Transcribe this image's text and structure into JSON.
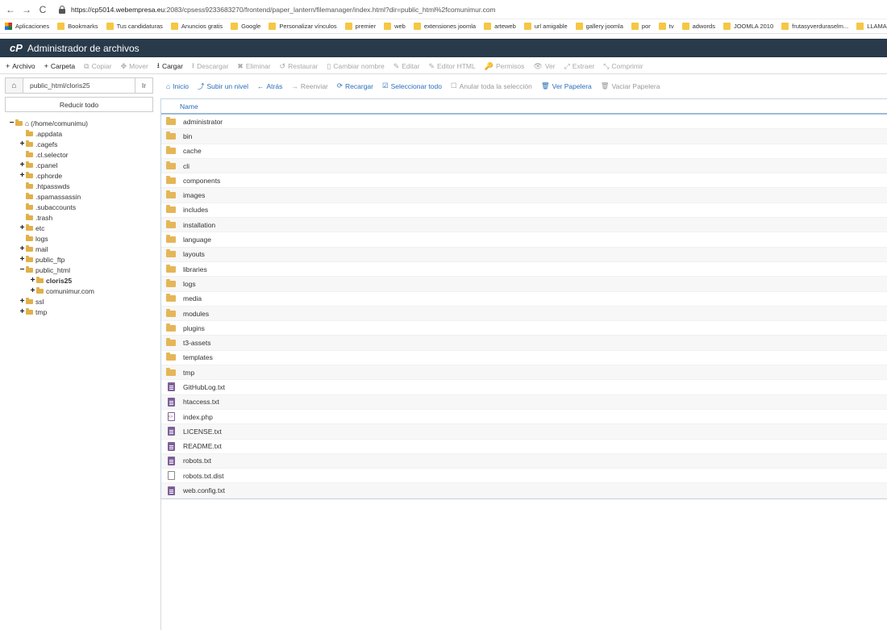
{
  "browser": {
    "back": "←",
    "forward": "→",
    "reload": "C",
    "url_host": "https://cp5014.webempresa.eu",
    "url_rest": ":2083/cpsess9233683270/frontend/paper_lantern/filemanager/index.html?dir=public_html%2fcomunimur.com",
    "bookmarks": [
      "Aplicaciones",
      "Bookmarks",
      "Tus candidaturas",
      "Anuncios gratis",
      "Google",
      "Personalizar vínculos",
      "premier",
      "web",
      "extensiones joomla",
      "arteweb",
      "url amigable",
      "gallery joomla",
      "por",
      "tv",
      "adwords",
      "JOOMLA 2010",
      "frutasyverduraselm...",
      "LLAMAR"
    ]
  },
  "header": {
    "logo": "cP",
    "title": "Administrador de archivos"
  },
  "toolbar": [
    {
      "label": "Archivo",
      "glyph": "+",
      "enabled": true
    },
    {
      "label": "Carpeta",
      "glyph": "+",
      "enabled": true
    },
    {
      "label": "Copiar",
      "glyph": "⧉",
      "enabled": false
    },
    {
      "label": "Mover",
      "glyph": "✥",
      "enabled": false
    },
    {
      "label": "Cargar",
      "glyph": "⭳",
      "enabled": true
    },
    {
      "label": "Descargar",
      "glyph": "⭳",
      "enabled": false
    },
    {
      "label": "Eliminar",
      "glyph": "✖",
      "enabled": false
    },
    {
      "label": "Restaurar",
      "glyph": "↺",
      "enabled": false
    },
    {
      "label": "Cambiar nombre",
      "glyph": "▯",
      "enabled": false
    },
    {
      "label": "Editar",
      "glyph": "✎",
      "enabled": false
    },
    {
      "label": "Editor HTML",
      "glyph": "✎",
      "enabled": false
    },
    {
      "label": "Permisos",
      "glyph": "🔑",
      "enabled": false
    },
    {
      "label": "Ver",
      "glyph": "👁",
      "enabled": false
    },
    {
      "label": "Extraer",
      "glyph": "⤢",
      "enabled": false
    },
    {
      "label": "Comprimir",
      "glyph": "⤡",
      "enabled": false
    }
  ],
  "sidebar": {
    "path_value": "public_html/cloris25",
    "go_label": "Ir",
    "collapse_label": "Reducir todo",
    "tree": [
      {
        "label": "(/home/comunimu)",
        "level": 0,
        "toggle": "−",
        "home": true
      },
      {
        "label": ".appdata",
        "level": 1,
        "toggle": ""
      },
      {
        "label": ".cagefs",
        "level": 1,
        "toggle": "+"
      },
      {
        "label": ".cl.selector",
        "level": 1,
        "toggle": ""
      },
      {
        "label": ".cpanel",
        "level": 1,
        "toggle": "+"
      },
      {
        "label": ".cphorde",
        "level": 1,
        "toggle": "+"
      },
      {
        "label": ".htpasswds",
        "level": 1,
        "toggle": ""
      },
      {
        "label": ".spamassassin",
        "level": 1,
        "toggle": ""
      },
      {
        "label": ".subaccounts",
        "level": 1,
        "toggle": ""
      },
      {
        "label": ".trash",
        "level": 1,
        "toggle": ""
      },
      {
        "label": "etc",
        "level": 1,
        "toggle": "+"
      },
      {
        "label": "logs",
        "level": 1,
        "toggle": ""
      },
      {
        "label": "mail",
        "level": 1,
        "toggle": "+"
      },
      {
        "label": "public_ftp",
        "level": 1,
        "toggle": "+"
      },
      {
        "label": "public_html",
        "level": 1,
        "toggle": "−"
      },
      {
        "label": "cloris25",
        "level": 2,
        "toggle": "+",
        "bold": true
      },
      {
        "label": "comunimur.com",
        "level": 2,
        "toggle": "+"
      },
      {
        "label": "ssl",
        "level": 1,
        "toggle": "+"
      },
      {
        "label": "tmp",
        "level": 1,
        "toggle": "+"
      }
    ]
  },
  "nav": [
    {
      "label": "Inicio",
      "glyph": "⌂",
      "enabled": true
    },
    {
      "label": "Subir un nivel",
      "glyph": "⤴",
      "enabled": true
    },
    {
      "label": "Atrás",
      "glyph": "←",
      "enabled": true
    },
    {
      "label": "Reenviar",
      "glyph": "→",
      "enabled": false
    },
    {
      "label": "Recargar",
      "glyph": "⟳",
      "enabled": true
    },
    {
      "label": "Seleccionar todo",
      "glyph": "☑",
      "enabled": true
    },
    {
      "label": "Anular toda la selección",
      "glyph": "☐",
      "enabled": false
    },
    {
      "label": "Ver Papelera",
      "glyph": "🗑",
      "enabled": true
    },
    {
      "label": "Vaciar Papelera",
      "glyph": "🗑",
      "enabled": false
    }
  ],
  "table": {
    "column_name": "Name",
    "rows": [
      {
        "name": "administrator",
        "type": "folder"
      },
      {
        "name": "bin",
        "type": "folder"
      },
      {
        "name": "cache",
        "type": "folder"
      },
      {
        "name": "cli",
        "type": "folder"
      },
      {
        "name": "components",
        "type": "folder"
      },
      {
        "name": "images",
        "type": "folder"
      },
      {
        "name": "includes",
        "type": "folder"
      },
      {
        "name": "installation",
        "type": "folder"
      },
      {
        "name": "language",
        "type": "folder"
      },
      {
        "name": "layouts",
        "type": "folder"
      },
      {
        "name": "libraries",
        "type": "folder"
      },
      {
        "name": "logs",
        "type": "folder"
      },
      {
        "name": "media",
        "type": "folder"
      },
      {
        "name": "modules",
        "type": "folder"
      },
      {
        "name": "plugins",
        "type": "folder"
      },
      {
        "name": "t3-assets",
        "type": "folder"
      },
      {
        "name": "templates",
        "type": "folder"
      },
      {
        "name": "tmp",
        "type": "folder"
      },
      {
        "name": "GitHubLog.txt",
        "type": "text"
      },
      {
        "name": "htaccess.txt",
        "type": "text"
      },
      {
        "name": "index.php",
        "type": "php"
      },
      {
        "name": "LICENSE.txt",
        "type": "text"
      },
      {
        "name": "README.txt",
        "type": "text"
      },
      {
        "name": "robots.txt",
        "type": "text"
      },
      {
        "name": "robots.txt.dist",
        "type": "blank"
      },
      {
        "name": "web.config.txt",
        "type": "text"
      }
    ]
  }
}
